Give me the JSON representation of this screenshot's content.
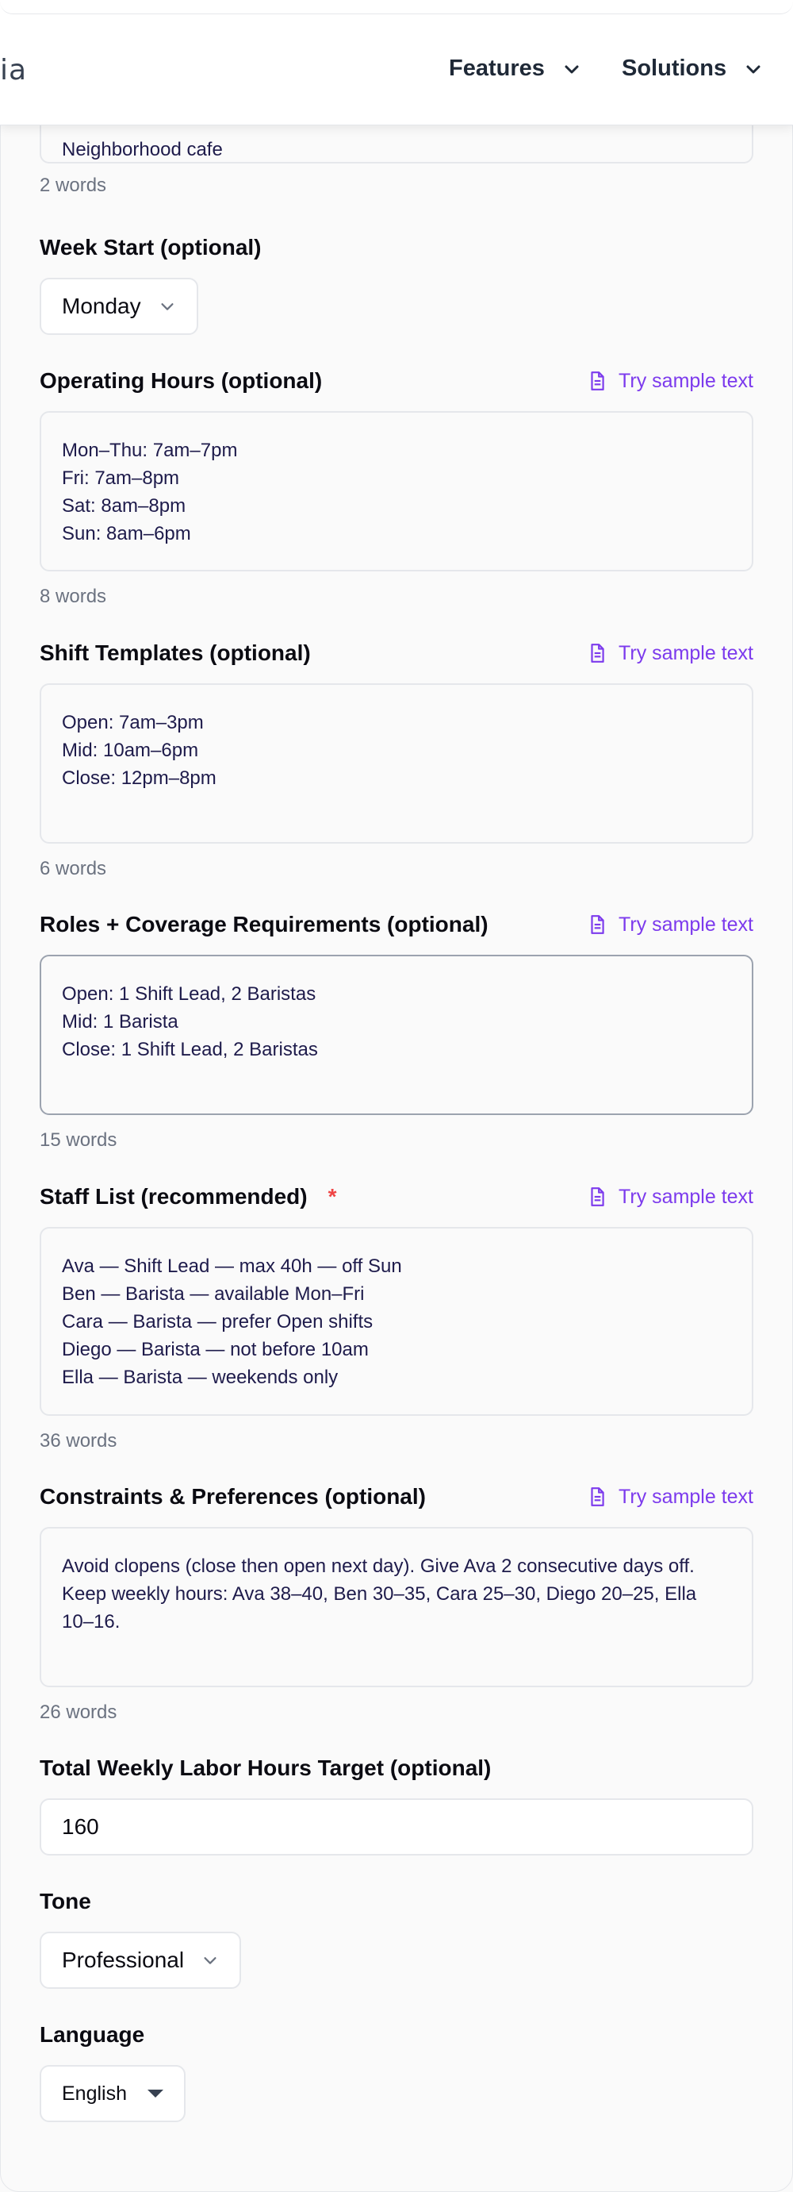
{
  "header": {
    "logo_fragment": "ia",
    "nav": [
      {
        "label": "Features"
      },
      {
        "label": "Solutions"
      }
    ]
  },
  "business_type": {
    "value_fragment": "Neighborhood cafe",
    "word_count": "2 words"
  },
  "week_start": {
    "label": "Week Start (optional)",
    "value": "Monday"
  },
  "sample_link_label": "Try sample text",
  "operating_hours": {
    "label": "Operating Hours (optional)",
    "value": "Mon–Thu: 7am–7pm\nFri: 7am–8pm\nSat: 8am–8pm\nSun: 8am–6pm",
    "word_count": "8 words"
  },
  "shift_templates": {
    "label": "Shift Templates (optional)",
    "value": "Open: 7am–3pm\nMid: 10am–6pm\nClose: 12pm–8pm",
    "word_count": "6 words"
  },
  "roles": {
    "label": "Roles + Coverage Requirements (optional)",
    "value": "Open: 1 Shift Lead, 2 Baristas\nMid: 1 Barista\nClose: 1 Shift Lead, 2 Baristas",
    "word_count": "15 words"
  },
  "staff": {
    "label": "Staff List (recommended)",
    "required_marker": "*",
    "value": "Ava — Shift Lead — max 40h — off Sun\nBen — Barista — available Mon–Fri\nCara — Barista — prefer Open shifts\nDiego — Barista — not before 10am\nElla — Barista — weekends only",
    "word_count": "36 words"
  },
  "constraints": {
    "label": "Constraints & Preferences (optional)",
    "value": "Avoid clopens (close then open next day). Give Ava 2 consecutive days off. Keep weekly hours: Ava 38–40, Ben 30–35, Cara 25–30, Diego 20–25, Ella 10–16.",
    "word_count": "26 words"
  },
  "labor_hours": {
    "label": "Total Weekly Labor Hours Target (optional)",
    "value": "160"
  },
  "tone": {
    "label": "Tone",
    "value": "Professional"
  },
  "language": {
    "label": "Language",
    "value": "English"
  },
  "colors": {
    "accent": "#7c3aed",
    "required": "#ef4444",
    "text": "#0b0b12",
    "muted": "#6b7280"
  }
}
